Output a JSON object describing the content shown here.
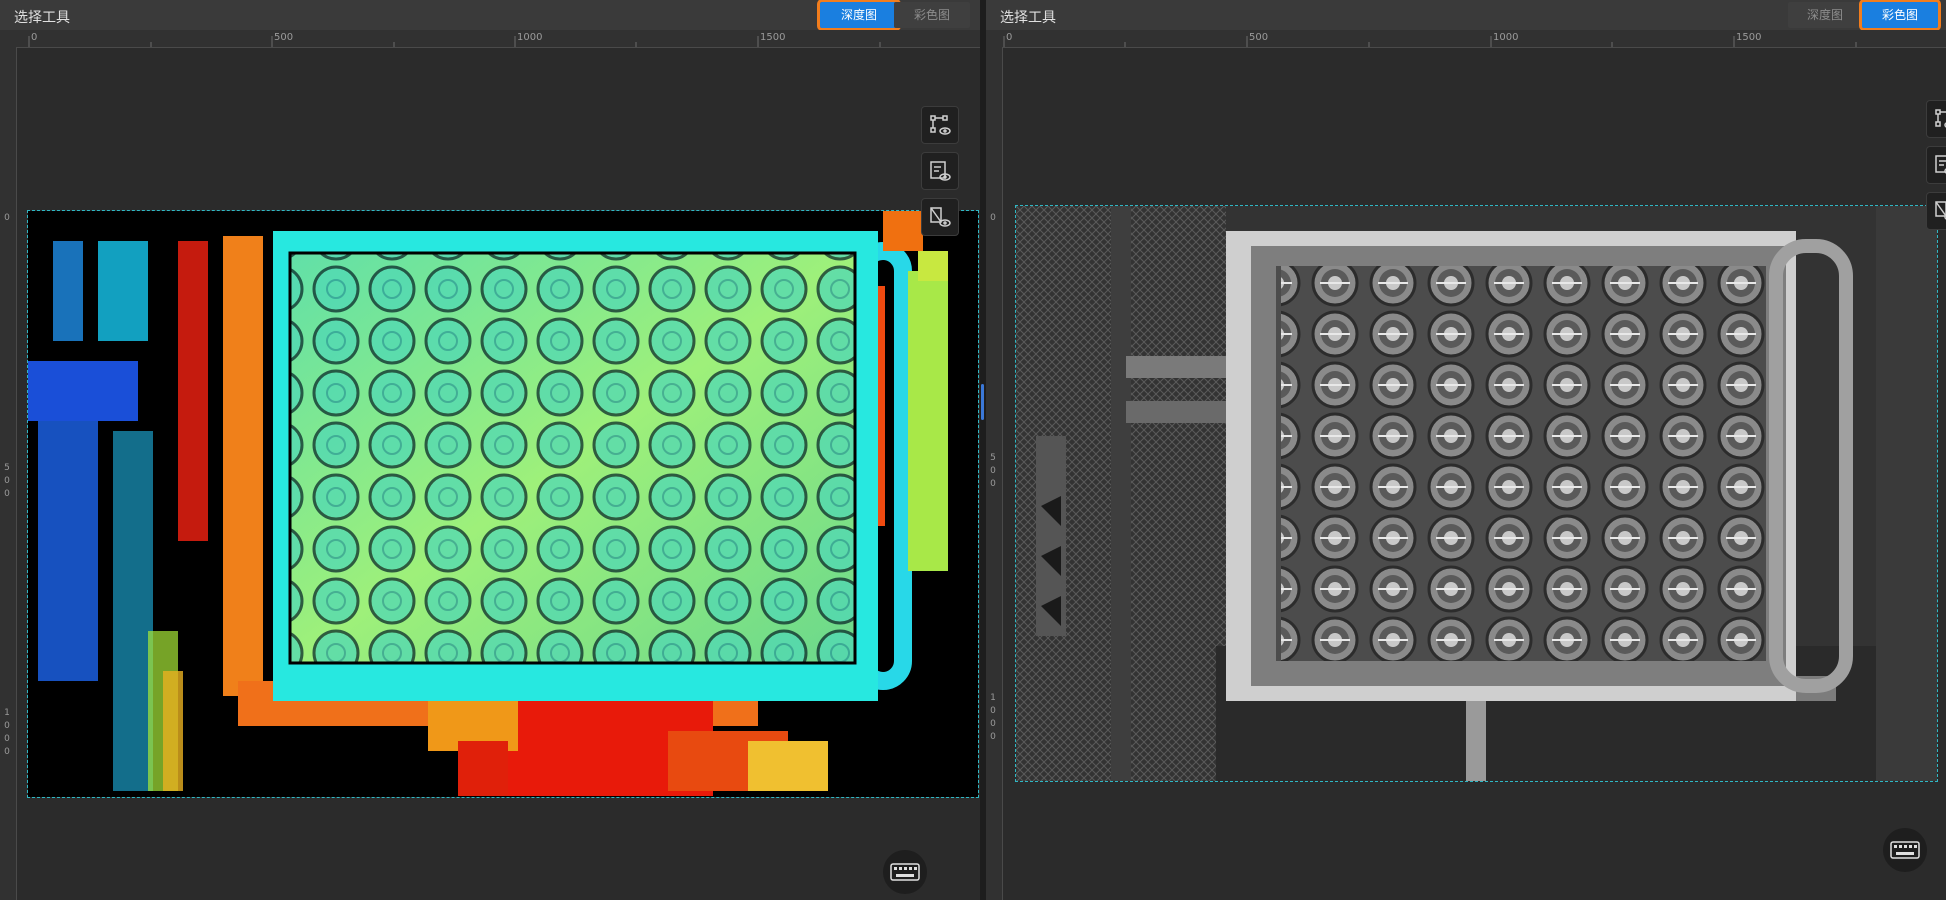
{
  "left_panel": {
    "title": "选择工具",
    "tabs": [
      {
        "label": "深度图",
        "active": true
      },
      {
        "label": "彩色图",
        "active": false
      }
    ],
    "ruler_h": [
      "0",
      "500",
      "1000",
      "1500"
    ],
    "ruler_v": [
      "0",
      "5\n0\n0",
      "1\n0\n0\n0"
    ],
    "image_kind": "depth-map"
  },
  "right_panel": {
    "title": "选择工具",
    "tabs": [
      {
        "label": "深度图",
        "active": false
      },
      {
        "label": "彩色图",
        "active": true
      }
    ],
    "ruler_h": [
      "0",
      "500",
      "1000",
      "1500"
    ],
    "ruler_v": [
      "0",
      "5\n0\n0",
      "1\n0\n0\n0"
    ],
    "image_kind": "grayscale-color-image"
  },
  "tools": [
    "select-region-icon",
    "point-cloud-view-icon",
    "erase-view-icon"
  ],
  "keyboard_icon": "keyboard-icon",
  "colors": {
    "accent": "#1a7fe0",
    "highlight_outline": "#f27d1d",
    "roi_dash": "#2fb7c4"
  }
}
